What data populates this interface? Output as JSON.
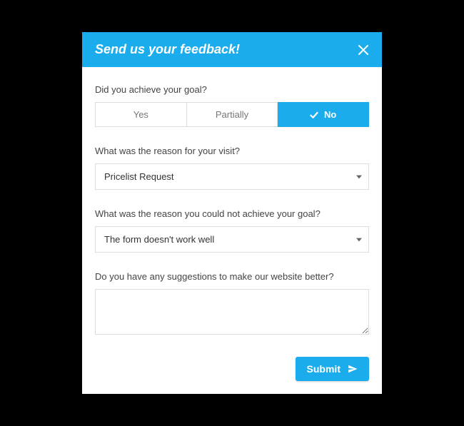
{
  "header": {
    "title": "Send us your feedback!"
  },
  "q1": {
    "label": "Did you achieve your goal?",
    "options": {
      "yes": "Yes",
      "partially": "Partially",
      "no": "No"
    },
    "selected": "no"
  },
  "q2": {
    "label": "What was the reason for your visit?",
    "value": "Pricelist Request"
  },
  "q3": {
    "label": "What was the reason you could not achieve your goal?",
    "value": "The form doesn't work well"
  },
  "q4": {
    "label": "Do you have any suggestions to make our website better?",
    "value": ""
  },
  "footer": {
    "submit_label": "Submit"
  }
}
